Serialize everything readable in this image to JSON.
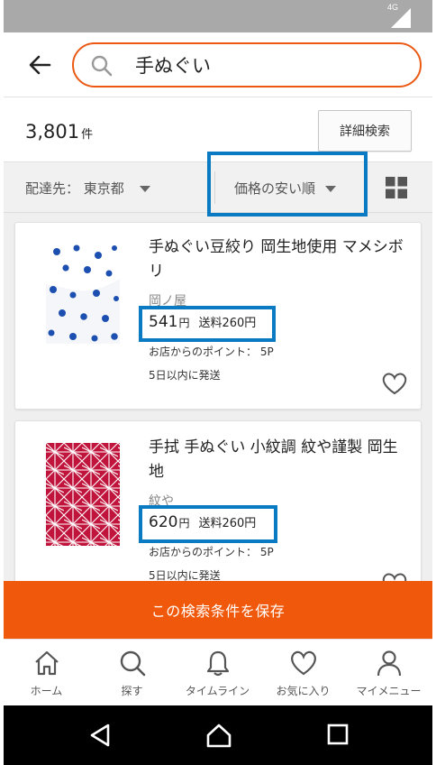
{
  "status_bar": {
    "network": "4G"
  },
  "search": {
    "query": "手ぬぐい"
  },
  "results": {
    "count": "3,801",
    "count_unit": "件",
    "detail_search_label": "詳細検索"
  },
  "filter": {
    "delivery_label": "配達先：",
    "delivery_value": "東京都",
    "sort_label": "価格の安い順"
  },
  "products": [
    {
      "title": "手ぬぐい豆絞り 岡生地使用 マメシボリ",
      "shop": "岡ノ屋",
      "price": "541",
      "price_unit": "円",
      "shipping": "送料260円",
      "points": "お店からのポイント： 5P",
      "ship_days": "5日以内に発送"
    },
    {
      "title": "手拭 手ぬぐい 小紋調 紋や謹製 岡生地",
      "shop": "紋や",
      "price": "620",
      "price_unit": "円",
      "shipping": "送料260円",
      "points": "お店からのポイント： 5P",
      "ship_days": "5日以内に発送"
    }
  ],
  "save_bar": {
    "label": "この検索条件を保存"
  },
  "bottom_nav": [
    {
      "label": "ホーム",
      "icon": "home-icon"
    },
    {
      "label": "探す",
      "icon": "search-icon"
    },
    {
      "label": "タイムライン",
      "icon": "bell-icon"
    },
    {
      "label": "お気に入り",
      "icon": "heart-icon"
    },
    {
      "label": "マイメニュー",
      "icon": "person-icon"
    }
  ],
  "colors": {
    "accent": "#f0590b",
    "highlight": "#0a7ac2"
  }
}
